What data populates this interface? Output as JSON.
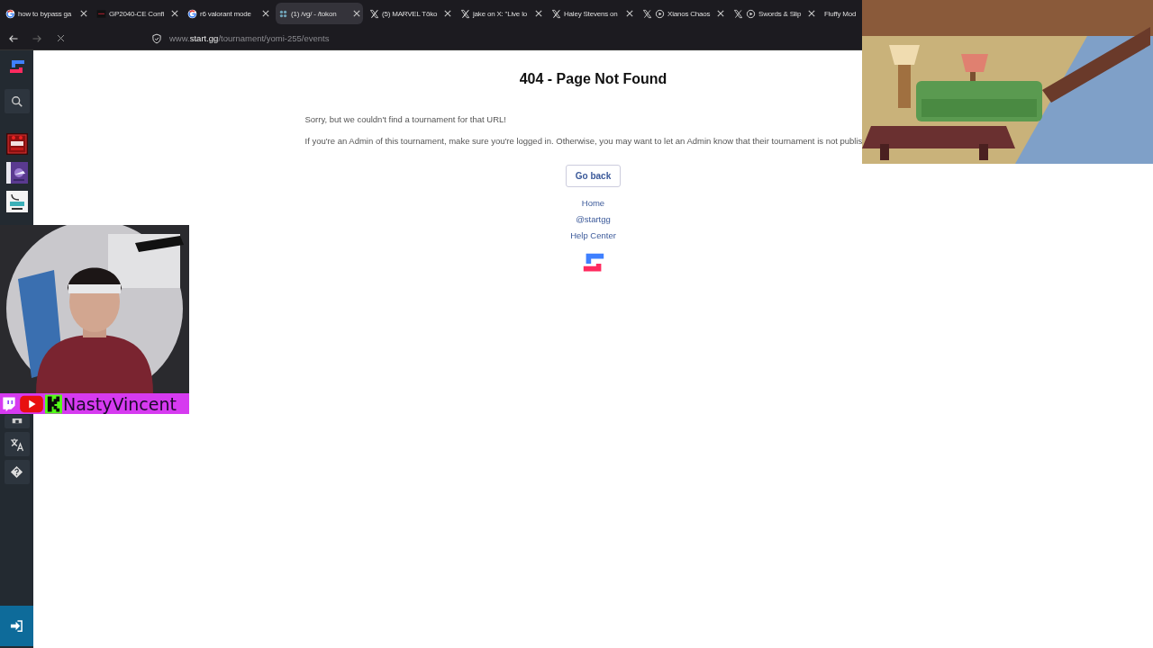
{
  "browser": {
    "tabs": [
      {
        "title": "how to bypass ga",
        "kind": "google",
        "selected": false,
        "closable": true
      },
      {
        "title": "GP2040-CE Confi",
        "kind": "dark-square",
        "selected": false,
        "closable": true
      },
      {
        "title": "r6 valorant mode",
        "kind": "google",
        "selected": false,
        "closable": true
      },
      {
        "title": "(1) /vg/ - /tokon",
        "kind": "clover",
        "selected": true,
        "closable": true
      },
      {
        "title": "(5) MARVEL Tōko",
        "kind": "x",
        "selected": false,
        "closable": true
      },
      {
        "title": "jake on X: \"Live lo",
        "kind": "x",
        "selected": false,
        "closable": true
      },
      {
        "title": "Haley Stevens on",
        "kind": "x",
        "selected": false,
        "closable": true
      },
      {
        "title": "Xianos Chaos",
        "kind": "x-play",
        "selected": false,
        "closable": true
      },
      {
        "title": "Swords & Slip",
        "kind": "x-play",
        "selected": false,
        "closable": true
      },
      {
        "title": "Fluffy Mod",
        "kind": "none",
        "selected": false,
        "closable": false
      }
    ],
    "back_disabled": false,
    "forward_disabled": true,
    "loading": true,
    "url": "www.**start.gg**/tournament/yomi-255/events"
  },
  "sidebar": {
    "items": [
      {
        "kind": "logo"
      },
      {
        "kind": "search"
      },
      {
        "kind": "picture"
      },
      {
        "kind": "picture"
      },
      {
        "kind": "picture"
      },
      {
        "kind": "shop"
      },
      {
        "kind": "translate"
      },
      {
        "kind": "help"
      },
      {
        "kind": "login"
      }
    ]
  },
  "page": {
    "heading": "404 - Page Not Found",
    "message": "Sorry, but we couldn't find a tournament for that URL!",
    "detail": "If you're an Admin of this tournament, make sure you're logged in. Otherwise, you may want to let an Admin know that their tournament is not publis",
    "button": "Go back",
    "links": [
      "Home",
      "@startgg",
      "Help Center"
    ]
  },
  "webcam": {
    "kind": "picture",
    "channel": "NastyVincent"
  },
  "video": {
    "kind": "picture"
  }
}
